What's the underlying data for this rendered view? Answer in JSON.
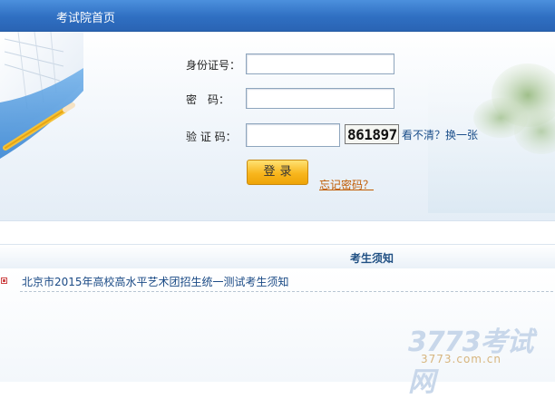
{
  "header": {
    "title": "考试院首页"
  },
  "login": {
    "id_label": "身份证号：",
    "id_value": "",
    "password_label": "密　码：",
    "password_value": "",
    "captcha_label": "验 证 码：",
    "captcha_value": "",
    "captcha_code": "861897",
    "refresh_label": "看不清？换一张",
    "submit_label": "登录",
    "forgot_label": "忘记密码？"
  },
  "notices": {
    "heading": "考生须知",
    "items": [
      {
        "title": "北京市2015年高校高水平艺术团招生统一测试考生须知"
      }
    ]
  },
  "watermark": {
    "main": "3773考试网",
    "sub": "3773.com.cn"
  },
  "colors": {
    "header_bar": "#2f6fc2",
    "button": "#f8b61d",
    "link": "#1a4a85",
    "forgot_link": "#c05a00"
  }
}
